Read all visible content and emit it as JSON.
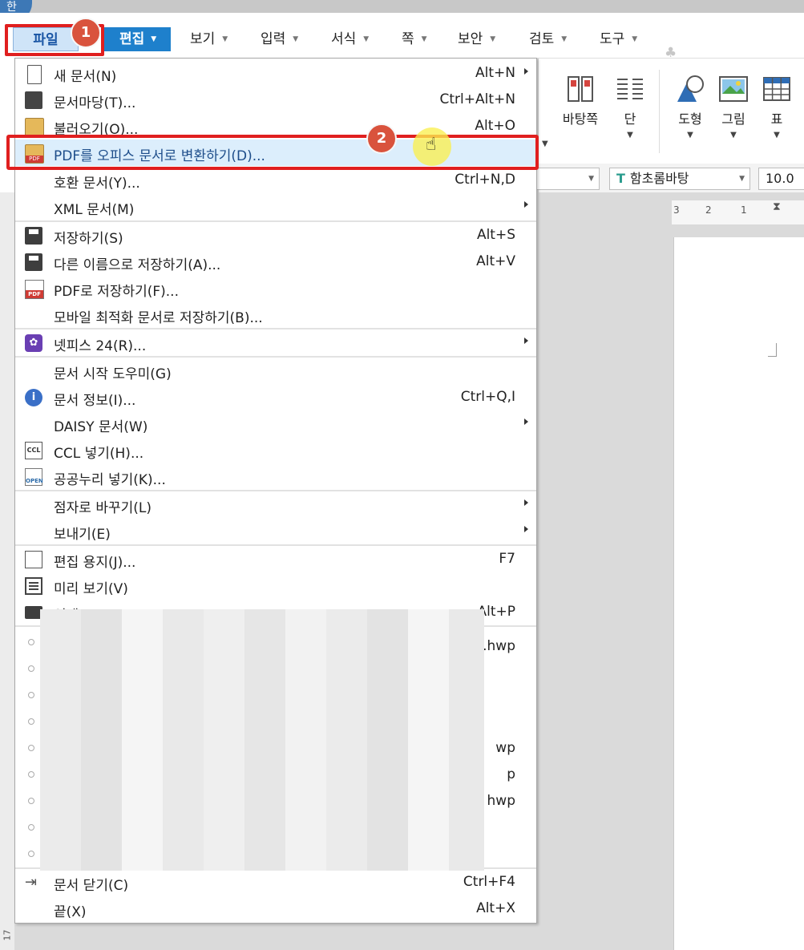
{
  "app": {
    "icon_text": "한"
  },
  "menubar": {
    "tabs": [
      {
        "label": "파일"
      },
      {
        "label": "편집"
      },
      {
        "label": "보기"
      },
      {
        "label": "입력"
      },
      {
        "label": "서식"
      },
      {
        "label": "쪽"
      },
      {
        "label": "보안"
      },
      {
        "label": "검토"
      },
      {
        "label": "도구"
      }
    ]
  },
  "annotations": {
    "step1": "1",
    "step2": "2"
  },
  "ribbon": {
    "master_page": "바탕쪽",
    "column": "단",
    "shape": "도형",
    "picture": "그림",
    "table": "표"
  },
  "format_bar": {
    "font_icon": "T",
    "font_name": "함초롬바탕",
    "font_size": "10.0"
  },
  "ruler": {
    "ticks": [
      "3",
      "2",
      "1"
    ]
  },
  "left_ruler": {
    "label": "17"
  },
  "file_menu": {
    "items": [
      {
        "label": "새 문서(N)",
        "shortcut": "Alt+N",
        "icon": "new-document-icon",
        "submenu": true
      },
      {
        "label": "문서마당(T)...",
        "shortcut": "Ctrl+Alt+N",
        "icon": "template-icon"
      },
      {
        "label": "불러오기(O)...",
        "shortcut": "Alt+O",
        "icon": "open-folder-icon"
      },
      {
        "label": "PDF를 오피스 문서로 변환하기(D)...",
        "shortcut": "",
        "icon": "pdf-folder-icon",
        "highlighted": true
      },
      {
        "label": "호환 문서(Y)...",
        "shortcut": "Ctrl+N,D"
      },
      {
        "label": "XML 문서(M)",
        "shortcut": "",
        "submenu": true
      },
      {
        "label": "저장하기(S)",
        "shortcut": "Alt+S",
        "icon": "save-icon"
      },
      {
        "label": "다른 이름으로 저장하기(A)...",
        "shortcut": "Alt+V",
        "icon": "save-as-icon"
      },
      {
        "label": "PDF로 저장하기(F)...",
        "shortcut": "",
        "icon": "pdf-save-icon"
      },
      {
        "label": "모바일 최적화 문서로 저장하기(B)...",
        "shortcut": ""
      },
      {
        "label": "넷피스 24(R)...",
        "shortcut": "",
        "icon": "netffice-icon",
        "submenu": true
      },
      {
        "label": "문서 시작 도우미(G)",
        "shortcut": ""
      },
      {
        "label": "문서 정보(I)...",
        "shortcut": "Ctrl+Q,I",
        "icon": "info-icon"
      },
      {
        "label": "DAISY 문서(W)",
        "shortcut": "",
        "submenu": true
      },
      {
        "label": "CCL 넣기(H)...",
        "shortcut": "",
        "icon": "ccl-icon"
      },
      {
        "label": "공공누리 넣기(K)...",
        "shortcut": "",
        "icon": "open-license-icon"
      },
      {
        "label": "점자로 바꾸기(L)",
        "shortcut": "",
        "submenu": true
      },
      {
        "label": "보내기(E)",
        "shortcut": "",
        "submenu": true
      },
      {
        "label": "편집 용지(J)...",
        "shortcut": "F7",
        "icon": "page-setup-icon"
      },
      {
        "label": "미리 보기(V)",
        "shortcut": "",
        "icon": "preview-icon"
      },
      {
        "label": "인쇄(P)",
        "shortcut": "Alt+P",
        "icon": "print-icon"
      }
    ],
    "recent_files_visible_fragments": [
      "ㅏ.hwp",
      "wp",
      "p",
      "hwp"
    ],
    "close": {
      "label": "문서 닫기(C)",
      "shortcut": "Ctrl+F4"
    },
    "exit": {
      "label": "끝(X)",
      "shortcut": "Alt+X"
    }
  }
}
